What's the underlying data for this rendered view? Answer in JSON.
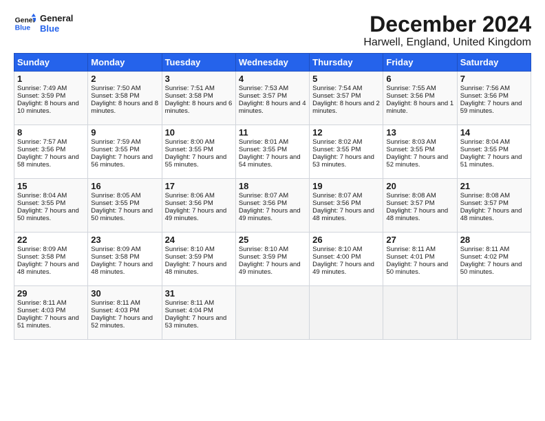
{
  "logo": {
    "line1": "General",
    "line2": "Blue"
  },
  "title": "December 2024",
  "subtitle": "Harwell, England, United Kingdom",
  "days_of_week": [
    "Sunday",
    "Monday",
    "Tuesday",
    "Wednesday",
    "Thursday",
    "Friday",
    "Saturday"
  ],
  "weeks": [
    [
      {
        "day": 1,
        "sunrise": "7:49 AM",
        "sunset": "3:59 PM",
        "daylight": "8 hours and 10 minutes."
      },
      {
        "day": 2,
        "sunrise": "7:50 AM",
        "sunset": "3:58 PM",
        "daylight": "8 hours and 8 minutes."
      },
      {
        "day": 3,
        "sunrise": "7:51 AM",
        "sunset": "3:58 PM",
        "daylight": "8 hours and 6 minutes."
      },
      {
        "day": 4,
        "sunrise": "7:53 AM",
        "sunset": "3:57 PM",
        "daylight": "8 hours and 4 minutes."
      },
      {
        "day": 5,
        "sunrise": "7:54 AM",
        "sunset": "3:57 PM",
        "daylight": "8 hours and 2 minutes."
      },
      {
        "day": 6,
        "sunrise": "7:55 AM",
        "sunset": "3:56 PM",
        "daylight": "8 hours and 1 minute."
      },
      {
        "day": 7,
        "sunrise": "7:56 AM",
        "sunset": "3:56 PM",
        "daylight": "7 hours and 59 minutes."
      }
    ],
    [
      {
        "day": 8,
        "sunrise": "7:57 AM",
        "sunset": "3:56 PM",
        "daylight": "7 hours and 58 minutes."
      },
      {
        "day": 9,
        "sunrise": "7:59 AM",
        "sunset": "3:55 PM",
        "daylight": "7 hours and 56 minutes."
      },
      {
        "day": 10,
        "sunrise": "8:00 AM",
        "sunset": "3:55 PM",
        "daylight": "7 hours and 55 minutes."
      },
      {
        "day": 11,
        "sunrise": "8:01 AM",
        "sunset": "3:55 PM",
        "daylight": "7 hours and 54 minutes."
      },
      {
        "day": 12,
        "sunrise": "8:02 AM",
        "sunset": "3:55 PM",
        "daylight": "7 hours and 53 minutes."
      },
      {
        "day": 13,
        "sunrise": "8:03 AM",
        "sunset": "3:55 PM",
        "daylight": "7 hours and 52 minutes."
      },
      {
        "day": 14,
        "sunrise": "8:04 AM",
        "sunset": "3:55 PM",
        "daylight": "7 hours and 51 minutes."
      }
    ],
    [
      {
        "day": 15,
        "sunrise": "8:04 AM",
        "sunset": "3:55 PM",
        "daylight": "7 hours and 50 minutes."
      },
      {
        "day": 16,
        "sunrise": "8:05 AM",
        "sunset": "3:55 PM",
        "daylight": "7 hours and 50 minutes."
      },
      {
        "day": 17,
        "sunrise": "8:06 AM",
        "sunset": "3:56 PM",
        "daylight": "7 hours and 49 minutes."
      },
      {
        "day": 18,
        "sunrise": "8:07 AM",
        "sunset": "3:56 PM",
        "daylight": "7 hours and 49 minutes."
      },
      {
        "day": 19,
        "sunrise": "8:07 AM",
        "sunset": "3:56 PM",
        "daylight": "7 hours and 48 minutes."
      },
      {
        "day": 20,
        "sunrise": "8:08 AM",
        "sunset": "3:57 PM",
        "daylight": "7 hours and 48 minutes."
      },
      {
        "day": 21,
        "sunrise": "8:08 AM",
        "sunset": "3:57 PM",
        "daylight": "7 hours and 48 minutes."
      }
    ],
    [
      {
        "day": 22,
        "sunrise": "8:09 AM",
        "sunset": "3:58 PM",
        "daylight": "7 hours and 48 minutes."
      },
      {
        "day": 23,
        "sunrise": "8:09 AM",
        "sunset": "3:58 PM",
        "daylight": "7 hours and 48 minutes."
      },
      {
        "day": 24,
        "sunrise": "8:10 AM",
        "sunset": "3:59 PM",
        "daylight": "7 hours and 48 minutes."
      },
      {
        "day": 25,
        "sunrise": "8:10 AM",
        "sunset": "3:59 PM",
        "daylight": "7 hours and 49 minutes."
      },
      {
        "day": 26,
        "sunrise": "8:10 AM",
        "sunset": "4:00 PM",
        "daylight": "7 hours and 49 minutes."
      },
      {
        "day": 27,
        "sunrise": "8:11 AM",
        "sunset": "4:01 PM",
        "daylight": "7 hours and 50 minutes."
      },
      {
        "day": 28,
        "sunrise": "8:11 AM",
        "sunset": "4:02 PM",
        "daylight": "7 hours and 50 minutes."
      }
    ],
    [
      {
        "day": 29,
        "sunrise": "8:11 AM",
        "sunset": "4:03 PM",
        "daylight": "7 hours and 51 minutes."
      },
      {
        "day": 30,
        "sunrise": "8:11 AM",
        "sunset": "4:03 PM",
        "daylight": "7 hours and 52 minutes."
      },
      {
        "day": 31,
        "sunrise": "8:11 AM",
        "sunset": "4:04 PM",
        "daylight": "7 hours and 53 minutes."
      },
      null,
      null,
      null,
      null
    ]
  ]
}
